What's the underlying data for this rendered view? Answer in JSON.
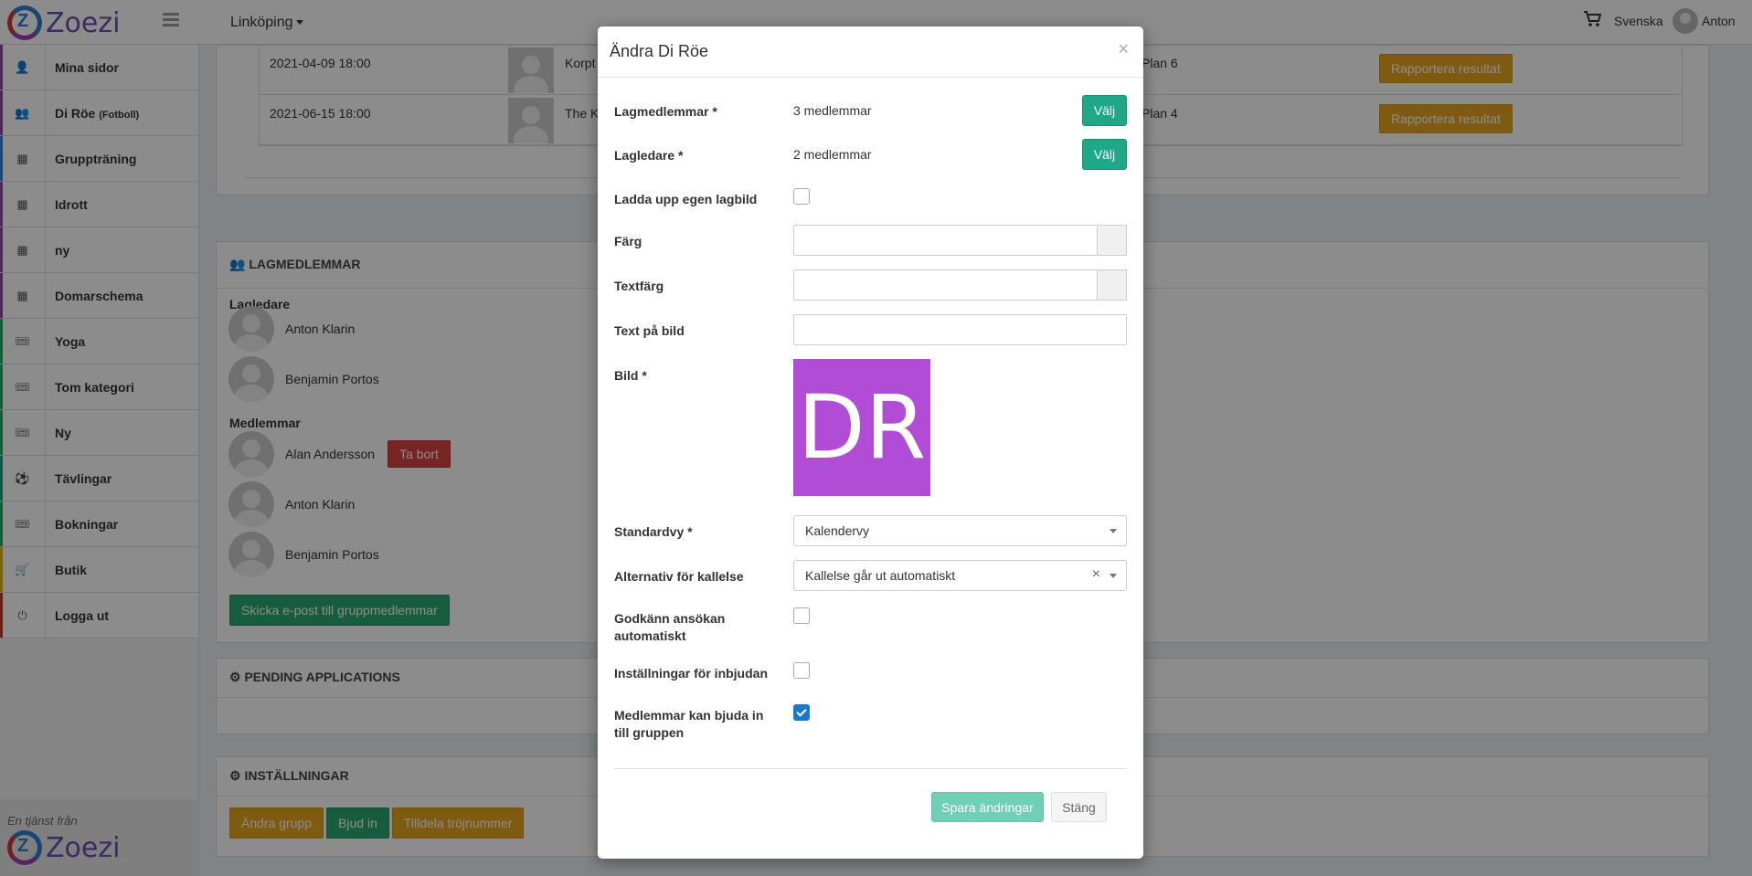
{
  "header": {
    "logo_text": "Zoezi",
    "city": "Linköping",
    "language": "Svenska",
    "user_name": "Anton"
  },
  "sidebar": {
    "items": [
      {
        "label": "Mina sidor",
        "sub": "",
        "icon": "user-icon",
        "glyph": "👤",
        "color": "#8e44ad"
      },
      {
        "label": "Di Röe",
        "sub": "(Fotboll)",
        "icon": "users-icon",
        "glyph": "👥",
        "color": "#8e44ad"
      },
      {
        "label": "Gruppträning",
        "sub": "",
        "icon": "calendar-icon",
        "glyph": "▦",
        "color": "#2e86de"
      },
      {
        "label": "Idrott",
        "sub": "",
        "icon": "calendar-icon",
        "glyph": "▦",
        "color": "#8e44ad"
      },
      {
        "label": "ny",
        "sub": "",
        "icon": "calendar-icon",
        "glyph": "▦",
        "color": "#8e44ad"
      },
      {
        "label": "Domarschema",
        "sub": "",
        "icon": "calendar-icon",
        "glyph": "▦",
        "color": "#8e44ad"
      },
      {
        "label": "Yoga",
        "sub": "",
        "icon": "ticket-icon",
        "glyph": "🎟",
        "color": "#27ae60"
      },
      {
        "label": "Tom kategori",
        "sub": "",
        "icon": "ticket-icon",
        "glyph": "🎟",
        "color": "#27ae60"
      },
      {
        "label": "Ny",
        "sub": "",
        "icon": "ticket-icon",
        "glyph": "🎟",
        "color": "#27ae60"
      },
      {
        "label": "Tävlingar",
        "sub": "",
        "icon": "soccer-ball-icon",
        "glyph": "⚽",
        "color": "#16a085"
      },
      {
        "label": "Bokningar",
        "sub": "",
        "icon": "ticket-icon",
        "glyph": "🎟",
        "color": "#27ae60"
      },
      {
        "label": "Butik",
        "sub": "",
        "icon": "cart-icon",
        "glyph": "🛒",
        "color": "#e6b800"
      },
      {
        "label": "Logga ut",
        "sub": "",
        "icon": "power-icon",
        "glyph": "⏻",
        "color": "#c0392b"
      }
    ],
    "footer_tagline": "En tjänst från",
    "footer_logo": "Zoezi"
  },
  "matches": {
    "rows": [
      {
        "datetime": "2021-04-09 18:00",
        "team": "Korpt",
        "place": "Plan 6",
        "action": "Rapportera resultat"
      },
      {
        "datetime": "2021-06-15 18:00",
        "team": "The K",
        "place": "Plan 4",
        "action": "Rapportera resultat"
      }
    ]
  },
  "members_panel": {
    "title": "LAGMEDLEMMAR",
    "leaders_heading": "Lagledare",
    "leaders": [
      "Anton Klarin",
      "Benjamin Portos"
    ],
    "members_heading": "Medlemmar",
    "members": [
      "Alan Andersson",
      "Anton Klarin",
      "Benjamin Portos"
    ],
    "remove_label": "Ta bort",
    "email_button": "Skicka e-post till gruppmedlemmar"
  },
  "pending_panel": {
    "title": "PENDING APPLICATIONS"
  },
  "settings_panel": {
    "title": "INSTÄLLNINGAR",
    "buttons": [
      "Ändra grupp",
      "Bjud in",
      "Tilldela tröjnummer"
    ]
  },
  "modal": {
    "title": "Ändra Di Röe",
    "close_glyph": "×",
    "fields": {
      "members_label": "Lagmedlemmar *",
      "members_value": "3 medlemmar",
      "leaders_label": "Lagledare *",
      "leaders_value": "2 medlemmar",
      "choose_label": "Välj",
      "upload_label": "Ladda upp egen lagbild",
      "color_label": "Färg",
      "textcolor_label": "Textfärg",
      "imgtext_label": "Text på bild",
      "image_label": "Bild *",
      "image_text": "DR",
      "image_color": "#b04cd6",
      "view_label": "Standardvy *",
      "view_value": "Kalendervy",
      "notice_label": "Alternativ för kallelse",
      "notice_value": "Kallelse går ut automatiskt",
      "autoapprove_label": "Godkänn ansökan automatiskt",
      "invite_settings_label": "Inställningar för inbjudan",
      "members_invite_label": "Medlemmar kan bjuda in till gruppen"
    },
    "checkboxes": {
      "upload": false,
      "autoapprove": false,
      "invite_settings": false,
      "members_invite": true
    },
    "save_label": "Spara ändringar",
    "close_label": "Stäng"
  }
}
